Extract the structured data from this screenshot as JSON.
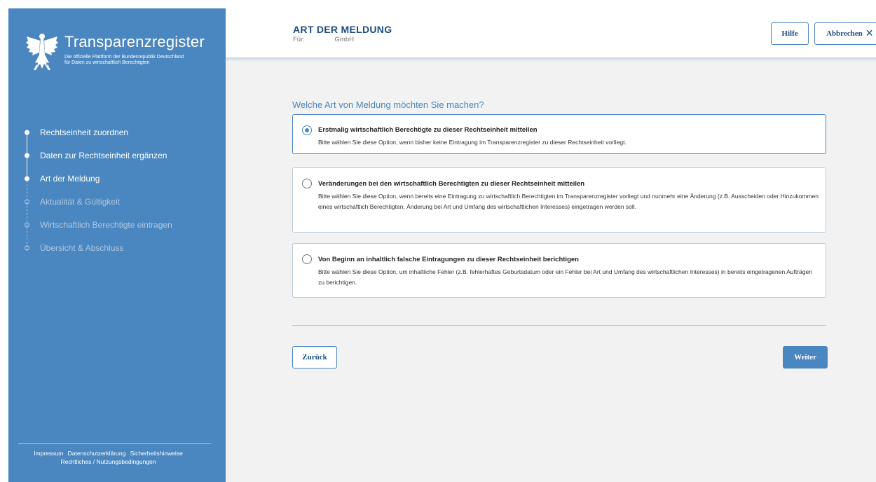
{
  "brand": {
    "title": "Transparenzregister",
    "subtitle_line1": "Die offizielle Plattform der Bundesrepublik Deutschland",
    "subtitle_line2": "für Daten zu wirtschaftlich Berechtigten"
  },
  "steps": [
    {
      "label": "Rechtseinheit zuordnen",
      "state": "done"
    },
    {
      "label": "Daten zur Rechtseinheit ergänzen",
      "state": "done"
    },
    {
      "label": "Art der Meldung",
      "state": "current"
    },
    {
      "label": "Aktualität & Gültigkeit",
      "state": "pending"
    },
    {
      "label": "Wirtschaftlich Berechtigte eintragen",
      "state": "pending"
    },
    {
      "label": "Übersicht & Abschluss",
      "state": "pending"
    }
  ],
  "footer": {
    "impressum": "Impressum",
    "datenschutz": "Datenschutzerklärung",
    "sicherheit": "Sicherheitshinweise",
    "rechtliches": "Rechtliches / Nutzungsbedingungen"
  },
  "header": {
    "title": "ART DER MELDUNG",
    "for_label": "Für:",
    "company": "GmbH",
    "help_label": "Hilfe",
    "cancel_label": "Abbrechen"
  },
  "main": {
    "question": "Welche Art von Meldung möchten Sie machen?",
    "options": [
      {
        "title": "Erstmalig wirtschaftlich Berechtigte zu dieser Rechtseinheit mitteilen",
        "description": "Bitte wählen Sie diese Option, wenn bisher keine Eintragung im Transparenzregister zu dieser Rechtseinheit vorliegt.",
        "selected": true
      },
      {
        "title": "Veränderungen bei den wirtschaftlich Berechtigten zu dieser Rechtseinheit mitteilen",
        "description": "Bitte wählen Sie diese Option, wenn bereits eine Eintragung zu wirtschaftlich Berechtigten im Transparenzregister vorliegt und nunmehr eine Änderung (z.B. Ausscheiden oder Hinzukommen eines wirtschaftlich Berechtigten, Änderung bei Art und Umfang des wirtschaftlichen Interesses) eingetragen werden soll.",
        "selected": false
      },
      {
        "title": "Von Beginn an inhaltlich falsche Eintragungen zu dieser Rechtseinheit berichtigen",
        "description": "Bitte wählen Sie diese Option, um inhaltliche Fehler (z.B. fehlerhaftes Geburtsdatum oder ein Fehler bei Art und Umfang des wirtschaftlichen Interesses) in bereits eingetragenen Aufträgen zu berichtigen.",
        "selected": false
      }
    ],
    "back_label": "Zurück",
    "next_label": "Weiter"
  },
  "colors": {
    "sidebar": "#4a86bf",
    "heading": "#1d4e80",
    "background": "#f2f2f2"
  }
}
